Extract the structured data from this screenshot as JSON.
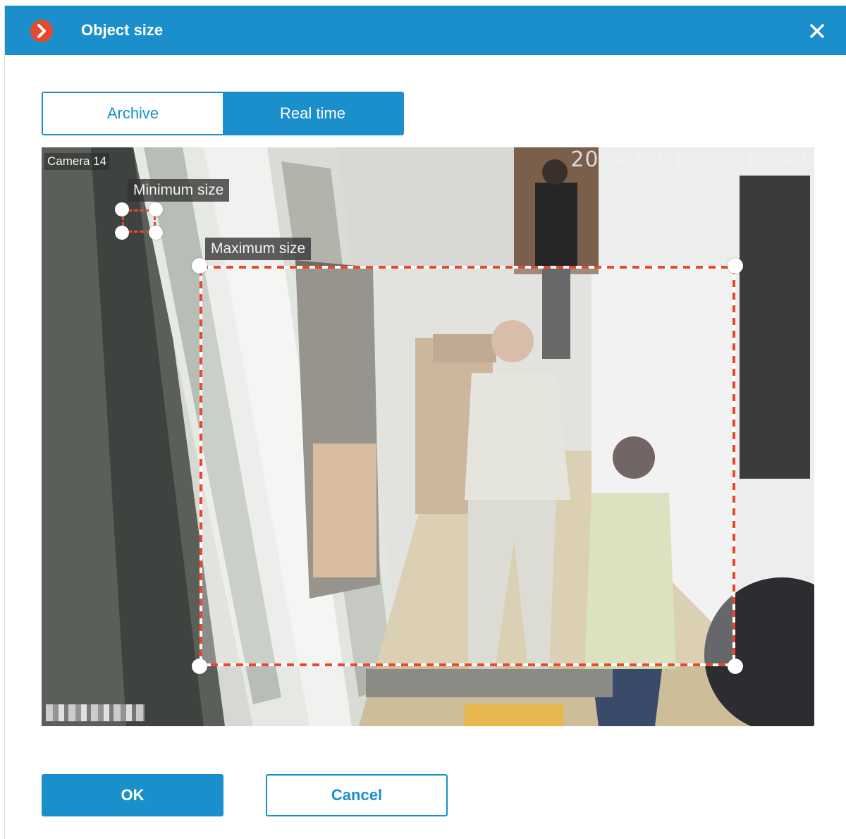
{
  "dialog": {
    "title": "Object size",
    "icon": "chevron-right-icon",
    "close_icon": "close-icon"
  },
  "tabs": [
    {
      "label": "Archive",
      "active": false
    },
    {
      "label": "Real time",
      "active": true
    }
  ],
  "video": {
    "camera_label": "Camera 14",
    "timestamp": "2014-08-15 15:13:47",
    "min_size_label": "Minimum size",
    "max_size_label": "Maximum size"
  },
  "buttons": {
    "ok": "OK",
    "cancel": "Cancel"
  },
  "colors": {
    "accent": "#1b8fcb",
    "icon_red": "#e64a2e",
    "box_dash_red": "#e64a2e",
    "box_dash_white": "#ffffff"
  }
}
